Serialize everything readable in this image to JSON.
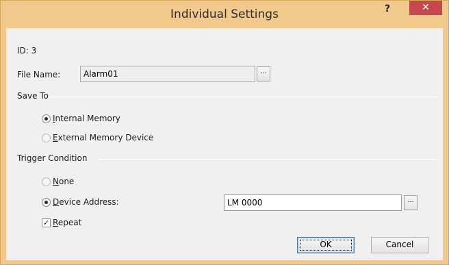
{
  "window": {
    "title": "Individual Settings",
    "help_label": "?",
    "close_label": "✕"
  },
  "id_label": "ID: 3",
  "file_name": {
    "label": "File Name:",
    "value": "Alarm01",
    "browse_label": "..."
  },
  "save_to": {
    "group_label": "Save To",
    "options": [
      {
        "accel": "I",
        "rest": "nternal Memory",
        "checked": true
      },
      {
        "accel": "E",
        "rest": "xternal Memory Device",
        "checked": false
      }
    ]
  },
  "trigger": {
    "group_label": "Trigger Condition",
    "none": {
      "accel": "N",
      "rest": "one",
      "checked": false
    },
    "device_address": {
      "accel": "D",
      "rest": "evice Address:",
      "checked": true,
      "value": "LM 0000",
      "browse_label": "..."
    },
    "repeat": {
      "accel": "R",
      "rest": "epeat",
      "checked": true,
      "check_glyph": "✓"
    }
  },
  "buttons": {
    "ok": "OK",
    "cancel": "Cancel"
  }
}
